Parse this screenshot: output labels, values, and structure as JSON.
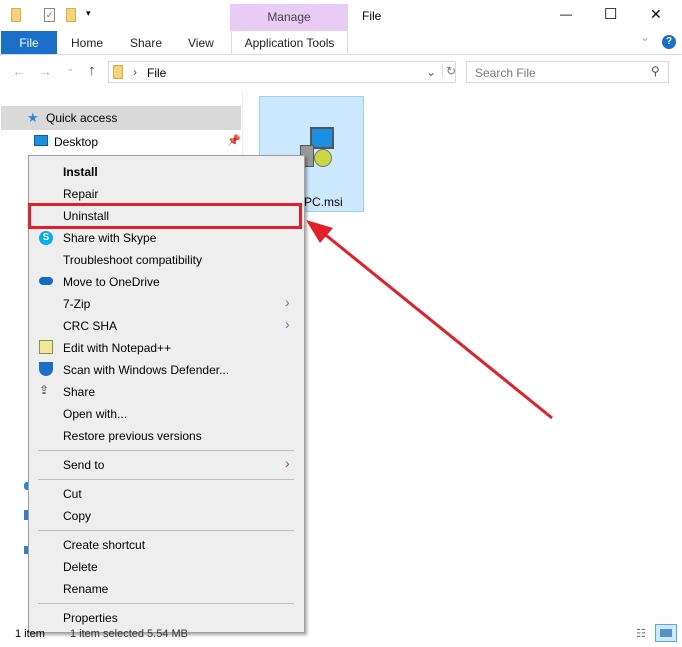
{
  "window": {
    "title": "File",
    "context_tab_group": "Manage",
    "minimize": "—",
    "maximize": "☐",
    "close": "✕"
  },
  "ribbon": {
    "tabs": [
      "File",
      "Home",
      "Share",
      "View",
      "Application Tools"
    ],
    "help": "?",
    "collapse": "⌄"
  },
  "address": {
    "back": "←",
    "forward": "→",
    "recent": "⌄",
    "up": "↑",
    "path": "File",
    "separator": "›",
    "dropdown": "⌄",
    "refresh": "↻",
    "search_placeholder": "Search File"
  },
  "sidebar": {
    "items": [
      {
        "label": "Quick access"
      },
      {
        "label": "Desktop"
      }
    ]
  },
  "file": {
    "name_visible": "PC.msi"
  },
  "context_menu": {
    "items": [
      {
        "label": "Install",
        "bold": true
      },
      {
        "label": "Repair"
      },
      {
        "label": "Uninstall",
        "highlighted": true
      },
      {
        "label": "Share with Skype",
        "icon": "skype-icon"
      },
      {
        "label": "Troubleshoot compatibility"
      },
      {
        "label": "Move to OneDrive",
        "icon": "onedrive-icon"
      },
      {
        "label": "7-Zip",
        "submenu": true
      },
      {
        "label": "CRC SHA",
        "submenu": true
      },
      {
        "label": "Edit with Notepad++",
        "icon": "notepad-icon"
      },
      {
        "label": "Scan with Windows Defender...",
        "icon": "defender-icon"
      },
      {
        "label": "Share",
        "icon": "share-icon"
      },
      {
        "label": "Open with..."
      },
      {
        "label": "Restore previous versions"
      },
      {
        "label": "Send to",
        "submenu": true
      },
      {
        "label": "Cut"
      },
      {
        "label": "Copy"
      },
      {
        "label": "Create shortcut"
      },
      {
        "label": "Delete"
      },
      {
        "label": "Rename"
      },
      {
        "label": "Properties"
      }
    ]
  },
  "status": {
    "count": "1 item",
    "selected": "1 item selected  5.54 MB"
  },
  "colors": {
    "accent": "#1a6fc9",
    "manage": "#e8ccf5",
    "highlight": "#e3202a",
    "selection": "#cce8ff"
  }
}
